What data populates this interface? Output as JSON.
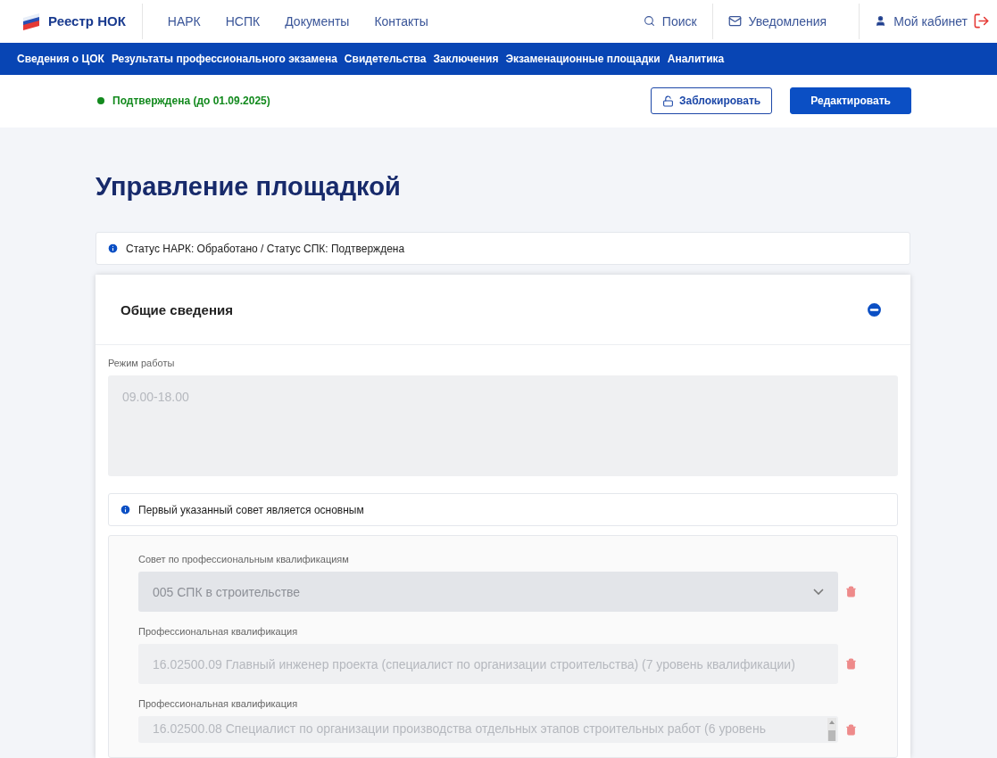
{
  "header": {
    "logo": "Реестр НОК",
    "nav": [
      "НАРК",
      "НСПК",
      "Документы",
      "Контакты"
    ],
    "search": "Поиск",
    "notifications": "Уведомления",
    "cabinet": "Мой кабинет"
  },
  "subnav": [
    "Сведения о ЦОК",
    "Результаты профессионального экзамена",
    "Свидетельства",
    "Заключения",
    "Экзаменационные площадки",
    "Аналитика"
  ],
  "status": {
    "text": "Подтверждена (до 01.09.2025)",
    "color": "#138a1e"
  },
  "actions": [
    {
      "label": "Заблокировать",
      "kind": "outline"
    },
    {
      "label": "Редактировать",
      "kind": "primary"
    }
  ],
  "page_title": "Управление площадкой",
  "notice": "Статус НАРК: Обработано / Статус СПК: Подтверждена",
  "section": {
    "title": "Общие сведения",
    "expanded": true,
    "schedule": {
      "label": "Режим работы",
      "value": "09.00-18.00",
      "disabled": true
    },
    "hint": "Первый указанный совет является основным",
    "fields": [
      {
        "kind": "select",
        "label": "Совет по профессиональным квалификациям",
        "value": "005 СПК в строительстве",
        "disabled": true
      },
      {
        "kind": "input",
        "label": "Профессиональная квалификация",
        "value": "16.02500.09 Главный инженер проекта (специалист по организации строительства) (7 уровень квалификации)",
        "disabled": true
      },
      {
        "kind": "textarea",
        "label": "Профессиональная квалификация",
        "value": "16.02500.08 Специалист по организации производства отдельных этапов строительных работ (6 уровень",
        "disabled": true
      }
    ]
  }
}
